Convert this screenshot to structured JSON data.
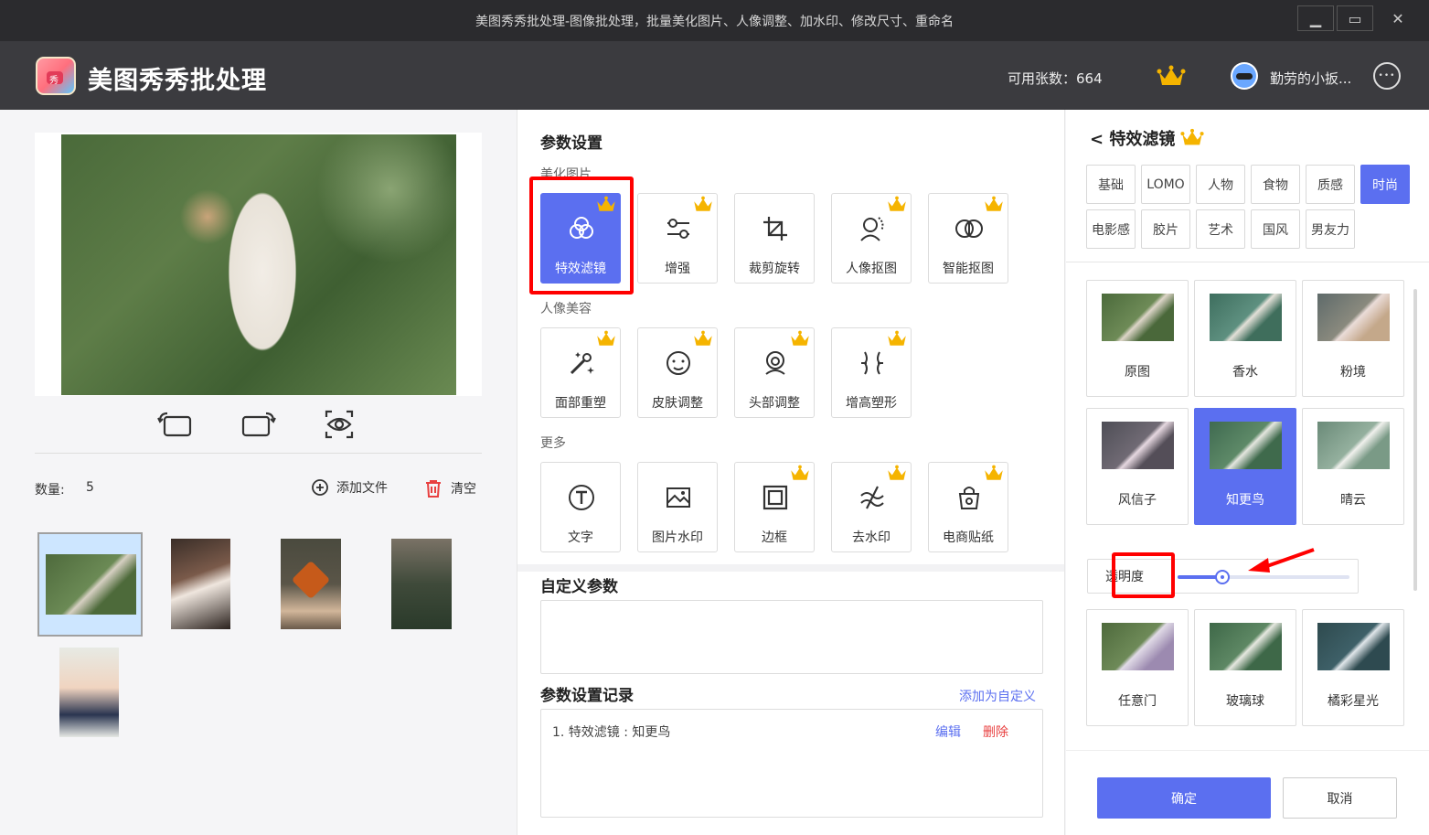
{
  "window": {
    "title": "美图秀秀批处理-图像批处理，批量美化图片、人像调整、加水印、修改尺寸、重命名",
    "minimize": "▁",
    "maximize": "▭",
    "close": "✕"
  },
  "header": {
    "logo_text": "秀",
    "app_name": "美图秀秀批处理",
    "quota_label": "可用张数：",
    "quota_value": "664",
    "username": "勤劳的小扳...",
    "more": "•••"
  },
  "left": {
    "count_label": "数量:",
    "count_value": "5",
    "add_files": "添加文件",
    "clear": "清空"
  },
  "params": {
    "title": "参数设置",
    "group_beautify": "美化图片",
    "group_portrait": "人像美容",
    "group_more": "更多",
    "beautify": [
      "特效滤镜",
      "增强",
      "裁剪旋转",
      "人像抠图",
      "智能抠图"
    ],
    "portrait": [
      "面部重塑",
      "皮肤调整",
      "头部调整",
      "增高塑形"
    ],
    "more": [
      "文字",
      "图片水印",
      "边框",
      "去水印",
      "电商贴纸"
    ],
    "custom_title": "自定义参数",
    "record_title": "参数设置记录",
    "add_custom": "添加为自定义",
    "record_item": "1.  特效滤镜 : 知更鸟",
    "record_edit": "编辑",
    "record_delete": "删除"
  },
  "filters": {
    "back_title": "< 特效滤镜",
    "categories": [
      "基础",
      "LOMO",
      "人物",
      "食物",
      "质感",
      "时尚",
      "电影感",
      "胶片",
      "艺术",
      "国风",
      "男友力"
    ],
    "active_category": "时尚",
    "items": [
      "原图",
      "香水",
      "粉境",
      "风信子",
      "知更鸟",
      "晴云",
      "任意门",
      "玻璃球",
      "橘彩星光"
    ],
    "active_item": "知更鸟",
    "opacity_label": "透明度",
    "opacity_value": 0.26,
    "confirm": "确定",
    "cancel": "取消"
  },
  "colors": {
    "accent": "#5b6ff0",
    "highlight": "#ff0000",
    "crown": "#f5b400",
    "delete": "#e84040"
  }
}
